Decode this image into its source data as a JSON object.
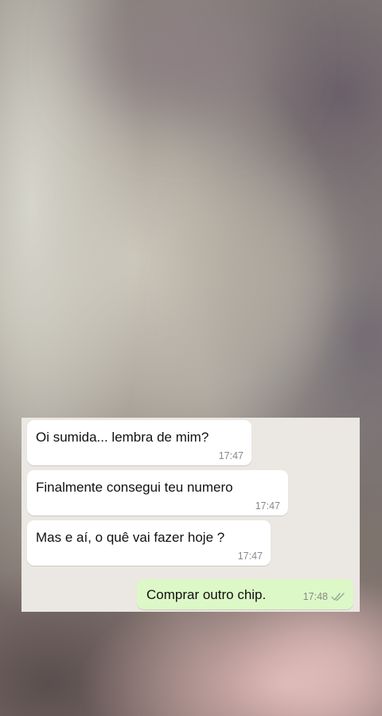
{
  "chat": {
    "messages": [
      {
        "direction": "incoming",
        "text": "Oi sumida... lembra de mim?",
        "time": "17:47"
      },
      {
        "direction": "incoming",
        "text": "Finalmente consegui teu numero",
        "time": "17:47"
      },
      {
        "direction": "incoming",
        "text": "Mas e aí, o quê vai fazer hoje ?",
        "time": "17:47"
      },
      {
        "direction": "outgoing",
        "text": "Comprar outro chip.",
        "time": "17:48",
        "status_icon": "double-check-icon"
      }
    ]
  },
  "colors": {
    "chat_background": "#ebe7e2",
    "incoming_bubble": "#ffffff",
    "outgoing_bubble": "#dcf8c6",
    "timestamp": "#8a8a8a"
  }
}
